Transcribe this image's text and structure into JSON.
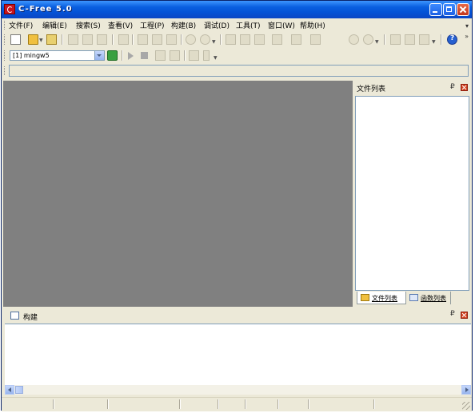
{
  "window": {
    "title": "C-Free 5.0",
    "minimize_icon": "minimize-icon",
    "maximize_icon": "maximize-icon",
    "close_icon": "close-icon",
    "accent": "#0a5fe0"
  },
  "menubar": {
    "items": [
      "文件(F)",
      "编辑(E)",
      "搜索(S)",
      "查看(V)",
      "工程(P)",
      "构建(B)",
      "调试(D)",
      "工具(T)",
      "窗口(W)",
      "帮助(H)"
    ]
  },
  "toolbar": {
    "icons": [
      "new-file-icon",
      "open-file-icon",
      "open-folder-icon",
      "save-icon",
      "save-all-icon",
      "close-file-icon",
      "print-icon",
      "cut-icon",
      "copy-icon",
      "paste-icon",
      "undo-icon",
      "redo-icon",
      "find-icon",
      "find-next-icon",
      "replace-icon",
      "goto-icon",
      "bookmark-icon",
      "compile-icon",
      "run-icon",
      "debug-icon",
      "help-icon"
    ]
  },
  "compiler": {
    "selected": "[1] mingw5"
  },
  "file_panel": {
    "title": "文件列表",
    "pin_symbol": "₽",
    "tabs": [
      {
        "label": "文件列表",
        "icon": "folder-icon",
        "active": true
      },
      {
        "label": "函数列表",
        "icon": "function-list-icon",
        "active": false
      }
    ]
  },
  "build_panel": {
    "title": "构建",
    "pin_symbol": "₽"
  },
  "colors": {
    "editor_background": "#808080",
    "chrome": "#ece9d8",
    "close_button": "#d2401e"
  }
}
